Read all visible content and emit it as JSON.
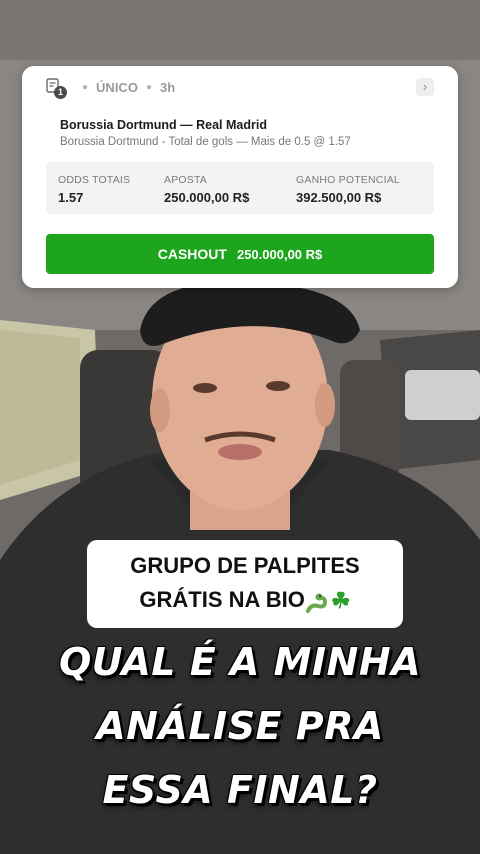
{
  "bet_card": {
    "badge_count": "1",
    "bet_type": "ÚNICO",
    "time_ago": "3h",
    "match": "Borussia Dortmund — Real Madrid",
    "market": "Borussia Dortmund - Total de gols — Mais de 0.5 @ 1.57",
    "stats": {
      "odds_label": "ODDS TOTAIS",
      "odds_value": "1.57",
      "stake_label": "APOSTA",
      "stake_value": "250.000,00 R$",
      "payout_label": "GANHO POTENCIAL",
      "payout_value": "392.500,00 R$"
    },
    "cashout_label": "CASHOUT",
    "cashout_amount": "250.000,00 R$",
    "accent_color": "#1ea51e"
  },
  "promo": {
    "line1": "GRUPO DE PALPITES",
    "line2": "GRÁTIS NA BIO"
  },
  "headline": {
    "line1": "QUAL É A MINHA",
    "line2": "ANÁLISE PRA",
    "line3": "ESSA FINAL?"
  }
}
